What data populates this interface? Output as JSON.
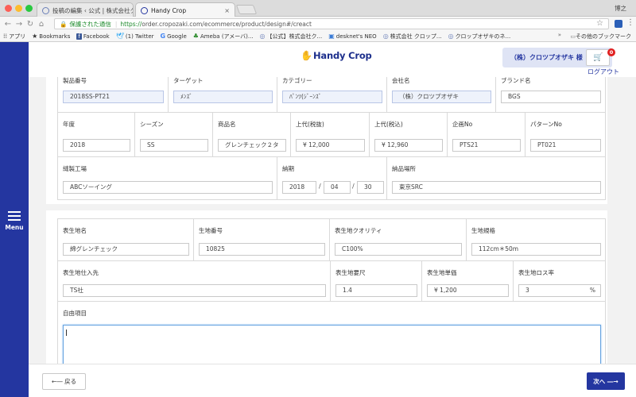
{
  "browser": {
    "tabs": [
      {
        "title": "投稿の編集 ‹ 公式 | 株式会社クロ",
        "close": "×"
      },
      {
        "title": "Handy Crop",
        "close": "×"
      }
    ],
    "user": "博之",
    "url_security_label": "保護された通信",
    "url_scheme": "https://",
    "url_rest": "order.cropozaki.com/ecommerce/product/design#/creact",
    "bookmarks": [
      {
        "icon": "apps-icon",
        "label": "アプリ"
      },
      {
        "icon": "star-icon",
        "label": "Bookmarks"
      },
      {
        "icon": "facebook-icon",
        "label": "Facebook"
      },
      {
        "icon": "twitter-icon",
        "label": "(1) Twitter"
      },
      {
        "icon": "google-icon",
        "label": "Google"
      },
      {
        "icon": "ameba-icon",
        "label": "Ameba (アメーバ)..."
      },
      {
        "icon": "site-icon",
        "label": "【公式】株式会社ク..."
      },
      {
        "icon": "desknets-icon",
        "label": "desknet's NEO"
      },
      {
        "icon": "site-icon",
        "label": "株式会社 クロップ..."
      },
      {
        "icon": "site-icon",
        "label": "クロップオザキのネ..."
      }
    ],
    "other_bookmarks": "その他のブックマーク"
  },
  "app": {
    "menu_label": "Menu",
    "logo_text": "Handy Crop",
    "company_name": "（株）クロツプオザキ 様",
    "cart_badge": "0",
    "logout": "ログアウト",
    "accent_color": "#2436a0"
  },
  "product": {
    "row1": [
      {
        "label": "製品番号",
        "value": "2018SS-PT21"
      },
      {
        "label": "ターゲット",
        "value": "ﾒﾝｽﾞ"
      },
      {
        "label": "カテゴリー",
        "value": "ﾊﾟﾝﾂ(ｼﾞｰﾝｽﾞ"
      },
      {
        "label": "会社名",
        "value": "（株）クロツプオザキ"
      },
      {
        "label": "ブランド名",
        "value": "BGS"
      }
    ],
    "row2": [
      {
        "label": "年度",
        "value": "2018"
      },
      {
        "label": "シーズン",
        "value": "SS"
      },
      {
        "label": "商品名",
        "value": "グレンチェック２タ"
      },
      {
        "label": "上代(税抜)",
        "value": "¥ 12,000"
      },
      {
        "label": "上代(税込)",
        "value": "¥ 12,960"
      },
      {
        "label": "企画No",
        "value": "PTS21"
      },
      {
        "label": "パターンNo",
        "value": "PT021"
      }
    ],
    "row3": {
      "factory_label": "縫製工場",
      "factory_value": "ABCソーイング",
      "delivery_label": "納期",
      "delivery_year": "2018",
      "delivery_month": "04",
      "delivery_day": "30",
      "date_sep": "/",
      "place_label": "納品場所",
      "place_value": "東京SRC"
    }
  },
  "fabric": {
    "row1": [
      {
        "label": "表生地名",
        "value": "綿グレンチェック"
      },
      {
        "label": "生地番号",
        "value": "10825"
      },
      {
        "label": "表生地クオリティ",
        "value": "C100%"
      },
      {
        "label": "生地規格",
        "value": "112cm＊50m"
      }
    ],
    "row2": [
      {
        "label": "表生地仕入先",
        "value": "TS社"
      },
      {
        "label": "表生地要尺",
        "value": "1.4"
      },
      {
        "label": "表生地単価",
        "value": "¥ 1,200"
      },
      {
        "label": "表生地ロス率",
        "value": "3",
        "unit": "%"
      }
    ],
    "free_label": "自由項目",
    "free_value": ""
  },
  "footer": {
    "back_label": "←― 戻る",
    "next_label": "次へ ―→"
  }
}
